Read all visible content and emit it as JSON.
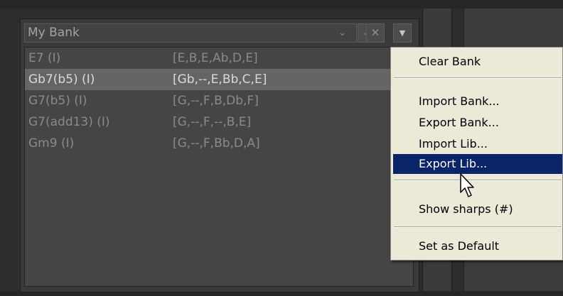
{
  "bank": {
    "selected": "My Bank",
    "confirm_icon": "✓",
    "cancel_icon": "✕",
    "menu_icon": "▼"
  },
  "chords": [
    {
      "name": "E7 (I)",
      "notes": "[E,B,E,Ab,D,E]",
      "selected": false
    },
    {
      "name": "Gb7(b5) (I)",
      "notes": "[Gb,--,E,Bb,C,E]",
      "selected": true
    },
    {
      "name": "G7(b5) (I)",
      "notes": "[G,--,F,B,Db,F]",
      "selected": false
    },
    {
      "name": "G7(add13) (I)",
      "notes": "[G,--,F,--,B,E]",
      "selected": false
    },
    {
      "name": "Gm9 (I)",
      "notes": "[G,--,F,Bb,D,A]",
      "selected": false
    }
  ],
  "menu": {
    "clear_bank": "Clear Bank",
    "import_bank": "Import Bank...",
    "export_bank": "Export Bank...",
    "import_lib": "Import Lib...",
    "export_lib": "Export Lib...",
    "show_sharps": "Show sharps (#)",
    "set_default": "Set as Default",
    "highlighted": "export_lib"
  },
  "colors": {
    "highlight": "#0a246a",
    "menu_bg": "#ece9d8",
    "selected_row": "#656565"
  }
}
